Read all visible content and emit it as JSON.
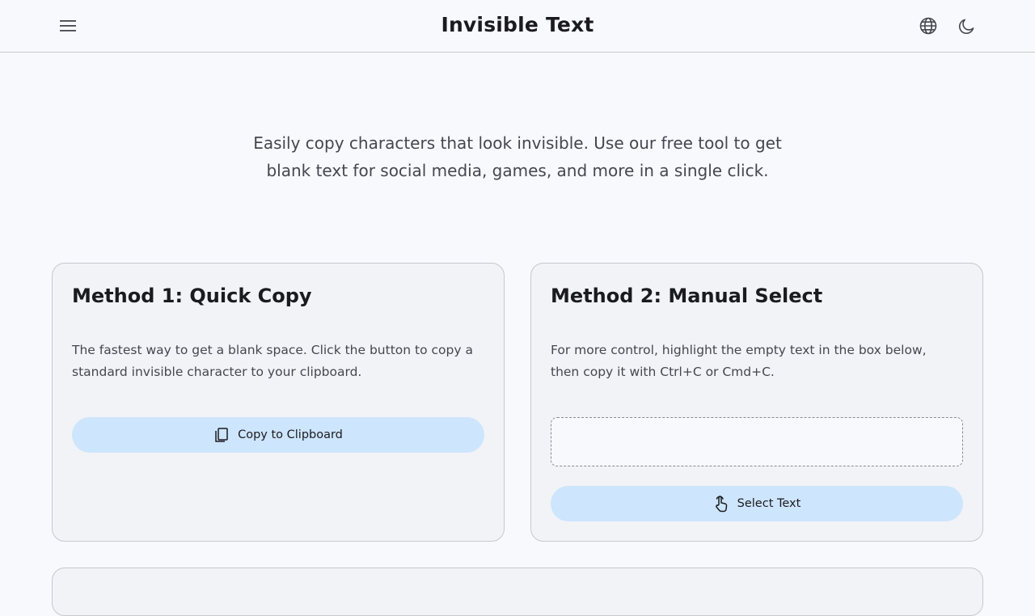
{
  "header": {
    "title": "Invisible Text",
    "menu_icon": "menu-icon",
    "language_icon": "globe-icon",
    "theme_icon": "moon-icon"
  },
  "intro": {
    "text": "Easily copy characters that look invisible. Use our free tool to get blank text for social media, games, and more in a single click."
  },
  "method1": {
    "title": "Method 1: Quick Copy",
    "description": "The fastest way to get a blank space. Click the button to copy a standard invisible character to your clipboard.",
    "button_label": "Copy to Clipboard",
    "button_icon": "copy-icon"
  },
  "method2": {
    "title": "Method 2: Manual Select",
    "description": "For more control, highlight the empty text in the box below, then copy it with Ctrl+C or Cmd+C.",
    "box_value": "ㅤ",
    "button_label": "Select Text",
    "button_icon": "pointer-hand-icon"
  },
  "colors": {
    "background": "#f8f9fd",
    "card": "#f2f3f7",
    "button": "#cde5fd",
    "text": "#1b1b1f"
  }
}
